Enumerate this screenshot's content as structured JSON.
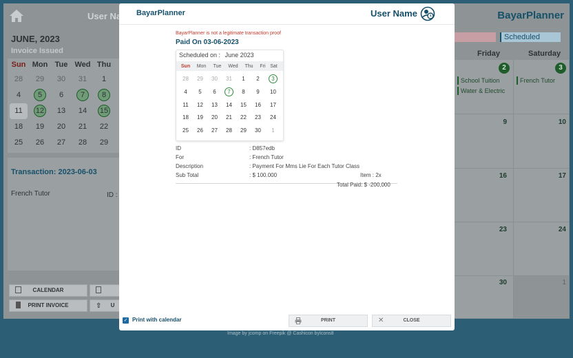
{
  "background": {
    "brand": "BayarPlanner",
    "username": "User Na",
    "month": "JUNE, 2023",
    "subtitle": "Invoice Issued",
    "weekdays": [
      "Sun",
      "Mon",
      "Tue",
      "Wed",
      "Thu"
    ],
    "mini_rows": [
      [
        "28",
        "29",
        "30",
        "31",
        "1"
      ],
      [
        "4",
        "5",
        "6",
        "7",
        "8"
      ],
      [
        "11",
        "12",
        "13",
        "14",
        "15"
      ],
      [
        "18",
        "19",
        "20",
        "21",
        "22"
      ],
      [
        "25",
        "26",
        "27",
        "28",
        "29"
      ]
    ],
    "transaction_title": "Transaction: 2023-06-03",
    "transaction_for": "French Tutor",
    "transaction_id_label": "ID :",
    "buttons": {
      "calendar": "CALENDAR",
      "print_invoice": "PRINT INVOICE",
      "upload": "U"
    },
    "scheduled_label": "Scheduled",
    "day_headers": [
      "Friday",
      "Saturday"
    ],
    "grid_days": [
      "2",
      "3",
      "9",
      "10",
      "16",
      "17",
      "23",
      "24",
      "30",
      "1"
    ],
    "events": {
      "fri_2": [
        "School Tuition",
        "Water & Electric"
      ],
      "sat_3": [
        "French Tutor"
      ]
    },
    "credits": "Image by jcomp  on Freepik @ Cashicon byIcons8"
  },
  "modal": {
    "brand": "BayarPlanner",
    "username": "User Name",
    "warning": "BayarPlanner is not a legitimate transaction proof",
    "paid_on": "Paid On 03-06-2023",
    "calendar": {
      "label": "Scheduled on :",
      "month": "June 2023",
      "weekdays": [
        "Sun",
        "Mon",
        "Tue",
        "Wed",
        "Thu",
        "Fri",
        "Sat"
      ],
      "weeks": [
        [
          "28",
          "29",
          "30",
          "31",
          "1",
          "2",
          "3"
        ],
        [
          "4",
          "5",
          "6",
          "7",
          "8",
          "9",
          "10"
        ],
        [
          "11",
          "12",
          "13",
          "14",
          "15",
          "16",
          "17"
        ],
        [
          "18",
          "19",
          "20",
          "21",
          "22",
          "23",
          "24"
        ],
        [
          "25",
          "26",
          "27",
          "28",
          "29",
          "30",
          "1"
        ]
      ]
    },
    "details": {
      "id_label": "ID",
      "id_value": ": D857edb",
      "for_label": "For",
      "for_value": ": French Tutor",
      "desc_label": "Description",
      "desc_value": ": Payment For Mms Lie For Each Tutor Class",
      "subtotal_label": "Sub Total",
      "subtotal_value": ": $ 100.000",
      "item": "Item : 2x",
      "total_paid": "Total Paid: $ -200,000"
    },
    "footer": {
      "print_with_calendar": "Print with calendar",
      "print": "PRINT",
      "close": "CLOSE"
    }
  }
}
